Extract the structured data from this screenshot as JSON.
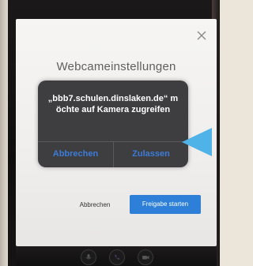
{
  "dialog": {
    "title": "Webcameinstellungen",
    "close_icon": "close-icon"
  },
  "permission_prompt": {
    "message": "„bbb7.schulen.dinslaken.de“ möchte auf Kamera zugreifen",
    "cancel_label": "Abbrechen",
    "allow_label": "Zulassen"
  },
  "footer": {
    "cancel_label": "Abbrechen",
    "start_label": "Freigabe starten"
  },
  "toolbar_icons": [
    "microphone-icon",
    "phone-icon",
    "camera-icon"
  ],
  "colors": {
    "accent_blue": "#2d7fd8",
    "prompt_bg": "#3e3e40",
    "prompt_button_text": "#3d7bd8",
    "arrow_cyan": "#4fb3e8"
  }
}
